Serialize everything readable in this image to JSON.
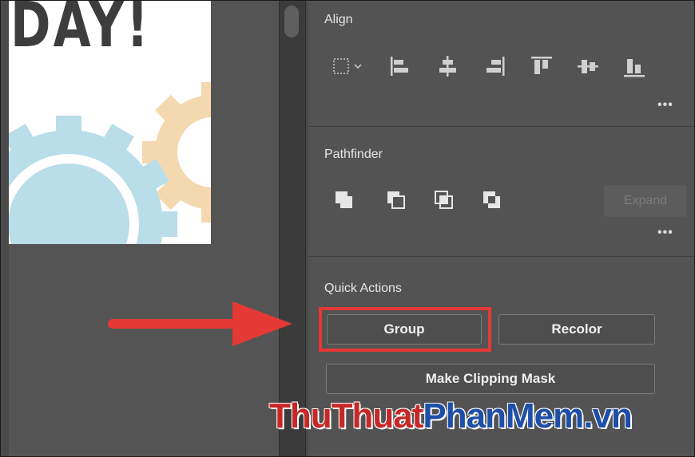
{
  "artboard": {
    "title": "DAY!"
  },
  "align": {
    "title": "Align",
    "icons": [
      "align-to-selection-icon",
      "horizontal-align-left-icon",
      "horizontal-align-center-icon",
      "horizontal-align-right-icon",
      "vertical-align-top-icon",
      "vertical-align-center-icon",
      "vertical-align-bottom-icon"
    ],
    "more": "•••"
  },
  "pathfinder": {
    "title": "Pathfinder",
    "icons": [
      "unite-icon",
      "minus-front-icon",
      "intersect-icon",
      "exclude-icon"
    ],
    "expand_label": "Expand",
    "more": "•••"
  },
  "quick_actions": {
    "title": "Quick Actions",
    "group_label": "Group",
    "recolor_label": "Recolor",
    "clipping_mask_label": "Make Clipping Mask"
  },
  "watermark": {
    "part1": "Thu",
    "part2": "Thuat",
    "part3": "PhanMem",
    "part4": ".vn"
  },
  "colors": {
    "highlight": "#e53935",
    "arrow": "#e53935",
    "panel_bg": "#535353",
    "gear_blue": "#b9dde9",
    "gear_peach": "#f4d9b0",
    "watermark_red": "#c62828",
    "watermark_blue": "#1e4fa8"
  }
}
